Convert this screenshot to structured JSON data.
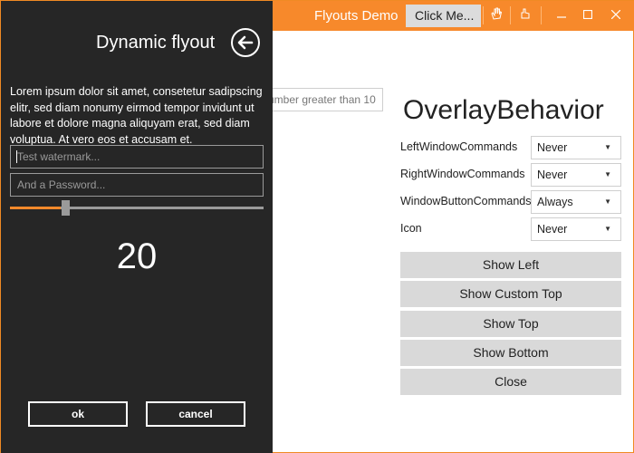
{
  "window": {
    "title": "Flyouts Demo",
    "click_button_label": "Click Me...",
    "accent_color": "#f7892b",
    "title_icons": [
      "hand-wave-icon",
      "hand-icon"
    ],
    "controls": [
      "minimize-icon",
      "maximize-icon",
      "close-icon"
    ]
  },
  "background": {
    "number_box_text": "umber greater than 10",
    "overlay_title": "OverlayBehavior",
    "options": [
      {
        "label": "LeftWindowCommands",
        "value": "Never"
      },
      {
        "label": "RightWindowCommands",
        "value": "Never"
      },
      {
        "label": "WindowButtonCommands",
        "value": "Always"
      },
      {
        "label": "Icon",
        "value": "Never"
      }
    ],
    "buttons": [
      "Show Left",
      "Show Custom Top",
      "Show Top",
      "Show Bottom",
      "Close"
    ]
  },
  "flyout": {
    "title": "Dynamic flyout",
    "back_icon": "arrow-left-circle-icon",
    "text": "Lorem ipsum dolor sit amet, consetetur sadipscing elitr, sed diam nonumy eirmod tempor invidunt ut labore et dolore magna aliquyam erat, sed diam voluptua. At vero eos et accusam et.",
    "watermark_placeholder": "Test watermark...",
    "password_placeholder": "And a Password...",
    "slider_value_fraction": 0.2,
    "value": "20",
    "ok_label": "ok",
    "cancel_label": "cancel"
  }
}
